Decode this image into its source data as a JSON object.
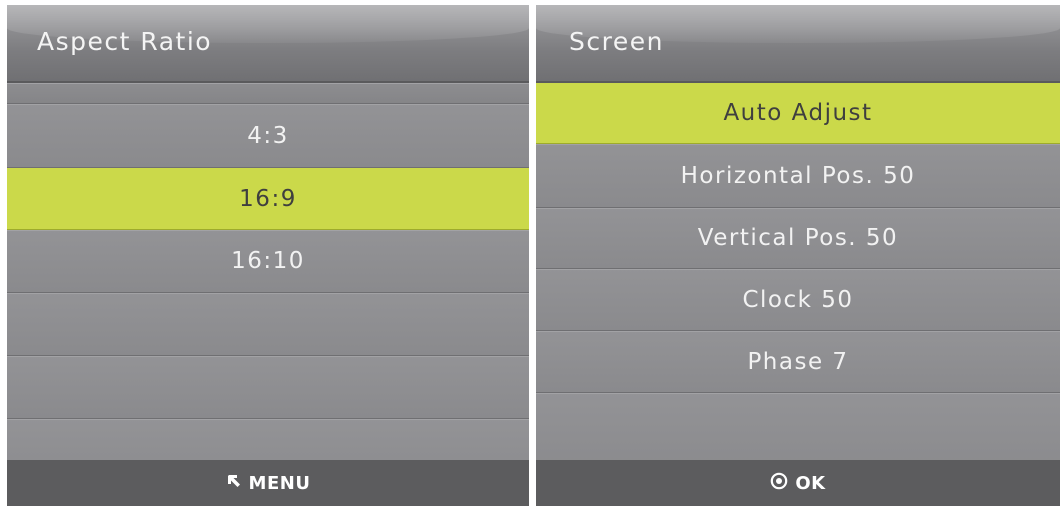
{
  "left_panel": {
    "title": "Aspect Ratio",
    "items": [
      {
        "label": "4:3",
        "selected": false
      },
      {
        "label": "16:9",
        "selected": true
      },
      {
        "label": "16:10",
        "selected": false
      },
      {
        "label": "",
        "selected": false
      },
      {
        "label": "",
        "selected": false
      },
      {
        "label": "",
        "selected": false
      }
    ],
    "footer": {
      "icon": "return-arrow-icon",
      "label": "MENU"
    }
  },
  "right_panel": {
    "title": "Screen",
    "items": [
      {
        "label": "Auto Adjust",
        "selected": true
      },
      {
        "label": "Horizontal Pos. 50",
        "selected": false
      },
      {
        "label": "Vertical Pos. 50",
        "selected": false
      },
      {
        "label": "Clock 50",
        "selected": false
      },
      {
        "label": "Phase 7",
        "selected": false
      },
      {
        "label": "",
        "selected": false
      }
    ],
    "footer": {
      "icon": "ok-circle-icon",
      "label": "OK"
    }
  },
  "colors": {
    "highlight": "#cbd94a",
    "panel": "#8a8a8c",
    "header": "#7d7d80",
    "footer": "#5c5c5e",
    "text": "#f2f2f2"
  }
}
